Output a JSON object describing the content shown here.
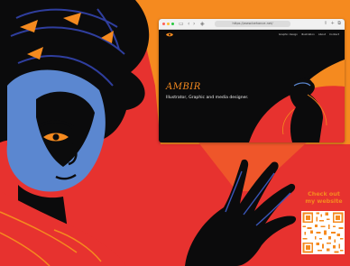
{
  "browser": {
    "url": "https://www.behance.net/",
    "nav_items": [
      "Graphic design",
      "Illustration",
      "About",
      "Contact"
    ],
    "logo_icon": "eye-logo-icon",
    "hero": {
      "name": "AMBIR",
      "tagline": "Illustrator, Graphic and media designer."
    }
  },
  "cta": {
    "line1": "Check out",
    "line2": "my website"
  },
  "qr_icon": "qr-code-icon",
  "colors": {
    "background_red": "#e7322f",
    "orange": "#f58a1f",
    "skin_blue": "#5b87d0",
    "ink": "#0b0b0c"
  }
}
